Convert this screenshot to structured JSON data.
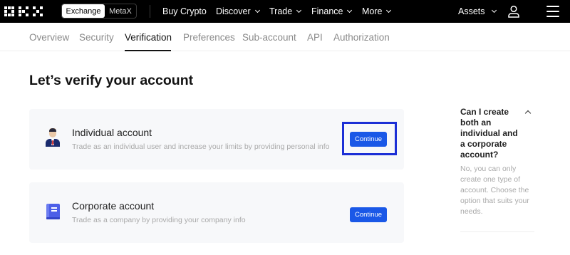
{
  "topbar": {
    "logo_text": "OKX",
    "switch": {
      "exchange": "Exchange",
      "metax": "MetaX"
    },
    "nav": {
      "buy_crypto": "Buy Crypto",
      "discover": "Discover",
      "trade": "Trade",
      "finance": "Finance",
      "more": "More",
      "assets": "Assets"
    },
    "icons": {
      "user": "user-icon",
      "menu": "hamburger-menu-icon"
    }
  },
  "subnav": {
    "tabs": [
      "Overview",
      "Security",
      "Verification",
      "Preferences",
      "Sub-account",
      "API",
      "Authorization"
    ],
    "active": "Verification"
  },
  "main": {
    "title": "Let’s verify your account",
    "individual": {
      "title": "Individual account",
      "description": "Trade as an individual user and increase your limits by providing personal info",
      "button": "Continue",
      "icon": "person-icon"
    },
    "corporate": {
      "title": "Corporate account",
      "description": "Trade as a company by providing your company info",
      "button": "Continue",
      "icon": "building-icon"
    }
  },
  "faq": {
    "question": "Can I create both an individual and a corporate account?",
    "answer": "No, you can only create one type of account. Choose the option that suits your needs."
  },
  "colors": {
    "topbar_bg": "#000000",
    "primary_button": "#1a58e7",
    "highlight_box": "#1c2fd6",
    "card_bg": "#f7f8fa"
  }
}
